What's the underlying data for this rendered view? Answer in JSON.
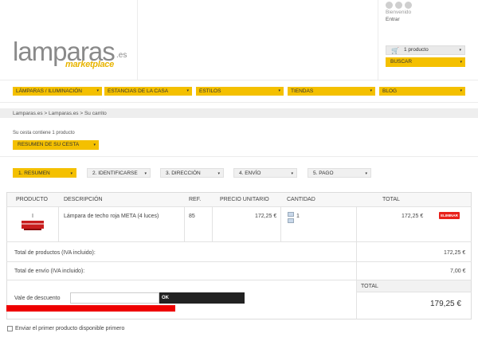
{
  "brand": {
    "name": "lamparas",
    "tld": ".es",
    "tagline": "marketplace"
  },
  "user": {
    "greeting": "Bienvenido",
    "login": "Entrar"
  },
  "header": {
    "cart_label": "1 producto",
    "search_label": "BUSCAR"
  },
  "nav": [
    {
      "label": "LÁMPARAS / ILUMINACIÓN"
    },
    {
      "label": "ESTANCIAS DE LA CASA"
    },
    {
      "label": "ESTILOS"
    },
    {
      "label": "TIENDAS"
    },
    {
      "label": "BLOG"
    }
  ],
  "breadcrumb": "Lamparas.es > Lamparas.es  >  Su carrito",
  "summary": {
    "text": "Su cesta contiene 1 producto",
    "button": "RESUMEN DE SU CESTA"
  },
  "steps": [
    {
      "label": "1. RESUMEN"
    },
    {
      "label": "2. IDENTIFICARSE"
    },
    {
      "label": "3. DIRECCIÓN"
    },
    {
      "label": "4. ENVÍO"
    },
    {
      "label": "5. PAGO"
    }
  ],
  "table": {
    "headers": {
      "product": "PRODUCTO",
      "description": "DESCRIPCIÓN",
      "ref": "REF.",
      "unit_price": "PRECIO UNITARIO",
      "quantity": "CANTIDAD",
      "total": "TOTAL"
    },
    "row": {
      "description": "Lámpara de techo roja META (4 luces)",
      "ref": "85",
      "unit_price": "172,25 €",
      "quantity": "1",
      "total": "172,25 €",
      "delete": "ELIMINAR"
    },
    "total_products_label": "Total de productos (IVA incluido):",
    "total_products_value": "172,25 €",
    "shipping_label": "Total de envío (IVA incluido):",
    "shipping_value": "7,00 €",
    "total_label": "TOTAL",
    "total_value": "179,25 €",
    "voucher_label": "Vale de descuento",
    "voucher_button": "OK"
  },
  "gift": {
    "label": "Enviar el primer producto disponible primero"
  },
  "colors": {
    "accent": "#f4c000",
    "delete": "#e8201a",
    "error_bar": "#ee0000"
  }
}
